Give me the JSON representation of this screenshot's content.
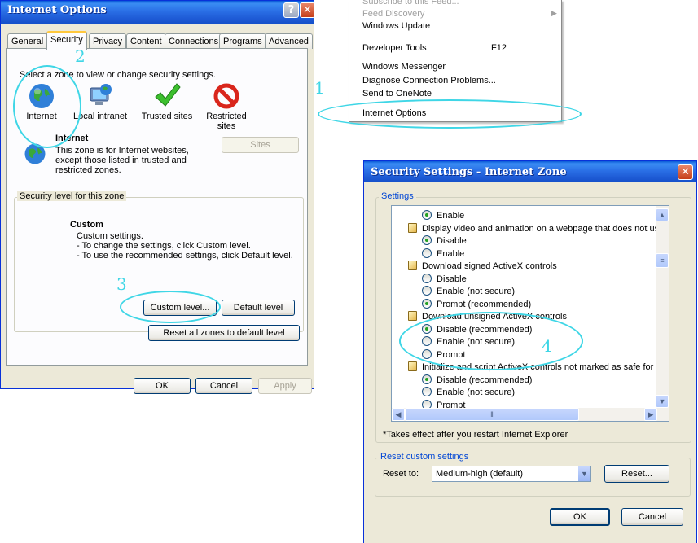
{
  "internet_options": {
    "title": "Internet Options",
    "tabs": [
      "General",
      "Security",
      "Privacy",
      "Content",
      "Connections",
      "Programs",
      "Advanced"
    ],
    "select_zone_text": "Select a zone to view or change security settings.",
    "zones": [
      {
        "label": "Internet",
        "icon": "globe-icon"
      },
      {
        "label": "Local intranet",
        "icon": "computer-globe-icon"
      },
      {
        "label": "Trusted sites",
        "icon": "checkmark-icon"
      },
      {
        "label": "Restricted sites",
        "icon": "no-entry-icon"
      }
    ],
    "zone_title": "Internet",
    "zone_description": "This zone is for Internet websites, except those listed in trusted and restricted zones.",
    "sites_button": "Sites",
    "security_level_label": "Security level for this zone",
    "level_name": "Custom",
    "level_desc_1": "Custom settings.",
    "level_desc_2": "- To change the settings, click Custom level.",
    "level_desc_3": "- To use the recommended settings, click Default level.",
    "custom_level_button": "Custom level...",
    "default_level_button": "Default level",
    "reset_all_button": "Reset all zones to default level",
    "ok_button": "OK",
    "cancel_button": "Cancel",
    "apply_button": "Apply"
  },
  "tools_menu": {
    "items": [
      {
        "label": "Subscribe to this Feed...",
        "disabled": true
      },
      {
        "label": "Feed Discovery",
        "disabled": true,
        "submenu": true
      },
      {
        "label": "Windows Update"
      },
      {
        "label": "Developer Tools",
        "shortcut": "F12"
      },
      {
        "label": "Windows Messenger"
      },
      {
        "label": "Diagnose Connection Problems..."
      },
      {
        "label": "Send to OneNote"
      },
      {
        "label": "Internet Options"
      }
    ]
  },
  "security_settings": {
    "title": "Security Settings - Internet Zone",
    "settings_label": "Settings",
    "rows": [
      {
        "kind": "radio",
        "label": "Enable",
        "checked": true
      },
      {
        "kind": "header",
        "label": "Display video and animation on a webpage that does not use"
      },
      {
        "kind": "radio",
        "label": "Disable",
        "checked": true
      },
      {
        "kind": "radio",
        "label": "Enable",
        "checked": false
      },
      {
        "kind": "header",
        "label": "Download signed ActiveX controls"
      },
      {
        "kind": "radio",
        "label": "Disable",
        "checked": false
      },
      {
        "kind": "radio",
        "label": "Enable (not secure)",
        "checked": false
      },
      {
        "kind": "radio",
        "label": "Prompt (recommended)",
        "checked": true
      },
      {
        "kind": "header",
        "label": "Download unsigned ActiveX controls"
      },
      {
        "kind": "radio",
        "label": "Disable (recommended)",
        "checked": true
      },
      {
        "kind": "radio",
        "label": "Enable (not secure)",
        "checked": false
      },
      {
        "kind": "radio",
        "label": "Prompt",
        "checked": false
      },
      {
        "kind": "header",
        "label": "Initialize and script ActiveX controls not marked as safe for s"
      },
      {
        "kind": "radio",
        "label": "Disable (recommended)",
        "checked": true
      },
      {
        "kind": "radio",
        "label": "Enable (not secure)",
        "checked": false
      },
      {
        "kind": "radio",
        "label": "Prompt",
        "checked": false
      }
    ],
    "note": "*Takes effect after you restart Internet Explorer",
    "reset_group_label": "Reset custom settings",
    "reset_to_label": "Reset to:",
    "reset_to_value": "Medium-high (default)",
    "reset_button": "Reset...",
    "ok_button": "OK",
    "cancel_button": "Cancel"
  },
  "annotations": [
    "1",
    "2",
    "3",
    "4"
  ],
  "colors": {
    "annotation": "#3fd6e6",
    "titlebar": "#1d59d4",
    "dialog_bg": "#ece9d8"
  }
}
